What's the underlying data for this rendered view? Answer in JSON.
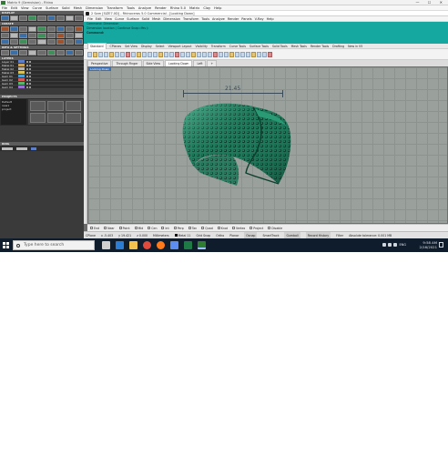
{
  "outer": {
    "title": "Matrix 9 (Gemvision) - Rhino",
    "window_controls": "—  ☐  ✕",
    "menu": [
      "File",
      "Edit",
      "View",
      "Curve",
      "Surface",
      "Solid",
      "Mesh",
      "Dimension",
      "Transform",
      "Tools",
      "Analyze",
      "Render",
      "Rhino 5.0",
      "Matrix",
      "Clay",
      "Help"
    ]
  },
  "left_panel": {
    "sections": {
      "display": "DISPLAY",
      "create": "CREATE",
      "info_settings": "INFO & SETTINGS",
      "layers": "LAYERS",
      "projects": "PROJECTS",
      "rings": "RING"
    },
    "layers": [
      "Layer 01",
      "Metal 01",
      "Metal 02",
      "Metal 03",
      "Gem 01",
      "Gem 02",
      "Gem 03",
      "Gem 04"
    ],
    "layer_colors": [
      "#5d7fc9",
      "#c9a35d",
      "#b5b5b5",
      "#d9c25e",
      "#4e9ed6",
      "#d65a5a",
      "#58b36b",
      "#9a6fd0"
    ],
    "projects": [
      "Default",
      "new1",
      "project"
    ]
  },
  "rhino": {
    "title": "2 Sam [SIZE7.0D] - Rhinoceros 5.0 Commercial - [Looking Down]",
    "menu": [
      "File",
      "Edit",
      "View",
      "Curve",
      "Surface",
      "Solid",
      "Mesh",
      "Dimension",
      "Transform",
      "Tools",
      "Analyze",
      "Render",
      "Panels",
      "V-Ray",
      "Help"
    ],
    "command_lines": [
      "Command: Dimension",
      "Dimension location ( Continue  Snap=Yes ):",
      "Command:"
    ],
    "toolbar_tabs": [
      "Standard",
      "CPlanes",
      "Set View",
      "Display",
      "Select",
      "Viewport Layout",
      "Visibility",
      "Transform",
      "Curve Tools",
      "Surface Tools",
      "Solid Tools",
      "Mesh Tools",
      "Render Tools",
      "Drafting",
      "New in V5"
    ],
    "viewport_tabs": [
      "Perspective",
      "Through Finger",
      "Side View",
      "Looking Down",
      "Left",
      "+"
    ],
    "viewport_label": "Looking Down",
    "dimension_value": "21.45",
    "osnaps": [
      "End",
      "Near",
      "Point",
      "Mid",
      "Cen",
      "Int",
      "Perp",
      "Tan",
      "Quad",
      "Knot",
      "Vertex",
      "Project",
      "Disable"
    ],
    "status": {
      "cplane": "CPlane",
      "x": "x -5.403",
      "y": "y 19.421",
      "z": "z 0.000",
      "units": "Millimeters",
      "layer": "Metal 11",
      "toggles": [
        "Grid Snap",
        "Ortho",
        "Planar",
        "Osnap",
        "SmartTrack",
        "Gumball",
        "Record History",
        "Filter"
      ],
      "memory": "Absolute tolerance: 0.001 MB"
    }
  },
  "taskbar": {
    "search_placeholder": "Type here to search",
    "lang": "ENG",
    "time": "9:58 AM",
    "date": "2/16/2021",
    "apps": [
      "task-view",
      "edge",
      "file-explorer",
      "chrome",
      "firefox",
      "mail",
      "excel",
      "rhino-matrix"
    ],
    "app_colors": [
      "#d0d0d0",
      "#2b7cd3",
      "#f2c14e",
      "#e04a3c",
      "#ff7a1a",
      "#5b8ef0",
      "#1d7a44",
      "#2e7d32"
    ]
  }
}
